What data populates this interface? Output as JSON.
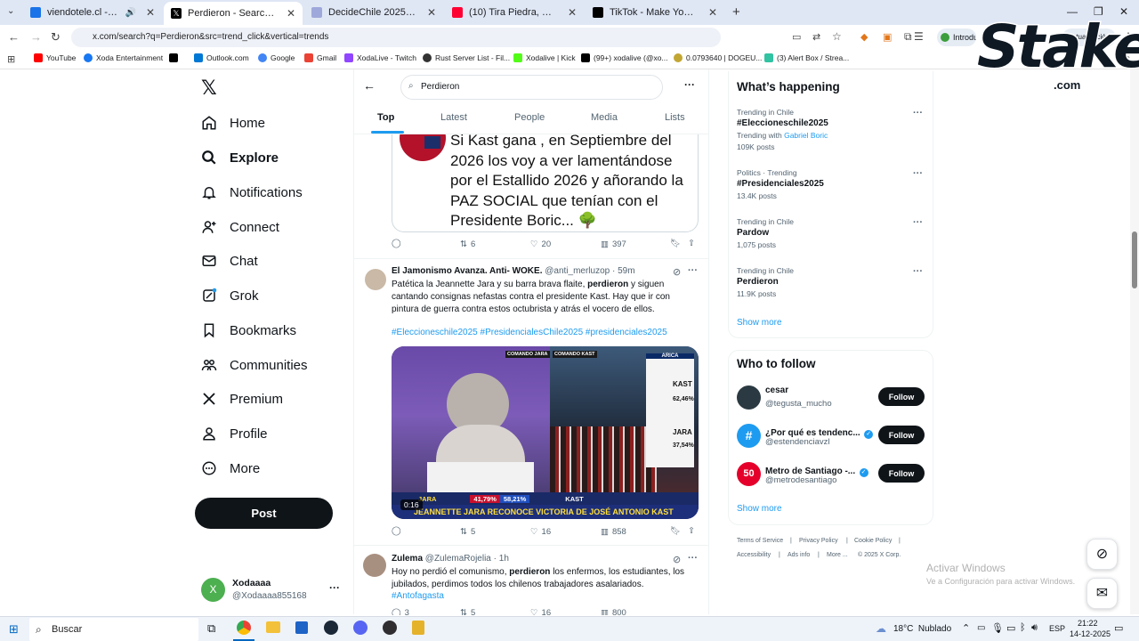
{
  "browser": {
    "tabs": [
      {
        "title": "viendotele.cl - Radios y can",
        "color": "#1a73e8"
      },
      {
        "title": "Perdieron - Search / X",
        "color": "#000000",
        "active": true
      },
      {
        "title": "DecideChile 2025 - La elección",
        "color": "#9fa8da"
      },
      {
        "title": "(10) Tira Piedra, Kuka Tira Piedra",
        "color": "#ff0033"
      },
      {
        "title": "TikTok - Make Your Day",
        "color": "#000000"
      }
    ],
    "url": "x.com/search?q=Perdieron&src=trend_click&vertical=trends",
    "profile_label": "Introdu",
    "update_label": "Actualización necesaria",
    "bookmarks": [
      {
        "label": "YouTube",
        "color": "#ff0000"
      },
      {
        "label": "Xoda Entertainment",
        "color": "#1877f2"
      },
      {
        "label": "",
        "color": "#000000"
      },
      {
        "label": "Outlook.com",
        "color": "#0078d4"
      },
      {
        "label": "Google",
        "color": "#4285f4"
      },
      {
        "label": "Gmail",
        "color": "#ea4335"
      },
      {
        "label": "XodaLive - Twitch",
        "color": "#9146ff"
      },
      {
        "label": "Rust Server List - Fil...",
        "color": "#333333"
      },
      {
        "label": "Xodalive | Kick",
        "color": "#53fc18"
      },
      {
        "label": "(99+) xodalive (@xo...",
        "color": "#000000"
      },
      {
        "label": "0.0793640 | DOGEU...",
        "color": "#c2a633"
      },
      {
        "label": "(3) Alert Box / Strea...",
        "color": "#31c3a2"
      }
    ],
    "bookmarks_more": "res"
  },
  "overlay": {
    "stake_logo": "Stake",
    "stake_sub": ".com"
  },
  "nav": {
    "items": [
      {
        "label": "Home",
        "icon": "home-icon"
      },
      {
        "label": "Explore",
        "icon": "search-icon"
      },
      {
        "label": "Notifications",
        "icon": "bell-icon"
      },
      {
        "label": "Connect",
        "icon": "person-plus-icon"
      },
      {
        "label": "Chat",
        "icon": "mail-icon"
      },
      {
        "label": "Grok",
        "icon": "grok-icon"
      },
      {
        "label": "Bookmarks",
        "icon": "bookmark-icon"
      },
      {
        "label": "Communities",
        "icon": "communities-icon"
      },
      {
        "label": "Premium",
        "icon": "x-logo-icon"
      },
      {
        "label": "Profile",
        "icon": "person-icon"
      },
      {
        "label": "More",
        "icon": "more-circle-icon"
      }
    ],
    "post_label": "Post",
    "account": {
      "name": "Xodaaaa",
      "handle": "@Xodaaaa855168",
      "initial": "X"
    }
  },
  "search": {
    "query": "Perdieron",
    "tabs": [
      "Top",
      "Latest",
      "People",
      "Media",
      "Lists"
    ]
  },
  "tweets": [
    {
      "quote_text": "Si Kast gana , en Septiembre del 2026 los voy a ver lamentándose por el Estallido 2026 y añorando la PAZ SOCIAL que tenían con el Presidente Boric... 🌳",
      "stats": {
        "replies": "",
        "retweets": "6",
        "likes": "20",
        "views": "397"
      }
    },
    {
      "name": "El Jamonismo Avanza. Anti- WOKE.",
      "handle": "@anti_merluzop",
      "time": "· 59m",
      "text_before": "Patética la Jeannette Jara y su barra brava flaite, ",
      "highlight": "perdieron",
      "text_after": " y siguen cantando consignas nefastas contra el presidente Kast. Hay que ir con pintura de guerra contra estos octubrista y atrás el vocero de ellos.",
      "hashtags": "#Eleccioneschile2025 #PresidencialesChile2025 #presidenciales2025",
      "video": {
        "duration": "0:16",
        "left_banner": "COMANDO JARA",
        "right_banner": "COMANDO KAST",
        "region": "ARICA",
        "kast_label": "KAST",
        "kast_pct": "62,46%",
        "jara_label": "JARA",
        "jara_pct": "37,54%",
        "bar_jara": "JARA",
        "bar_jara_pct": "41,79%",
        "bar_kast_pct": "58,21%",
        "bar_kast": "KAST",
        "headline": "JEANNETTE JARA RECONOCE VICTORIA DE JOSÉ ANTONIO KAST"
      },
      "stats": {
        "replies": "",
        "retweets": "5",
        "likes": "16",
        "views": "858"
      }
    },
    {
      "name": "Zulema",
      "handle": "@ZulemaRojelia",
      "time": "· 1h",
      "text_before": "Hoy no perdió el comunismo, ",
      "highlight": "perdieron",
      "text_after": " los enfermos, los estudiantes, los jubilados, perdimos todos los chilenos trabajadores asalariados.",
      "hashtags": "#Antofagasta",
      "stats": {
        "replies": "3",
        "retweets": "5",
        "likes": "16",
        "views": "800"
      }
    }
  ],
  "right": {
    "happening_title": "What’s happening",
    "trends": [
      {
        "context": "Trending in Chile",
        "name": "#Eleccioneschile2025",
        "with_prefix": "Trending with ",
        "with": "Gabriel Boric",
        "posts": "109K posts"
      },
      {
        "context": "Politics · Trending",
        "name": "#Presidenciales2025",
        "posts": "13.4K posts"
      },
      {
        "context": "Trending in Chile",
        "name": "Pardow",
        "posts": "1,075 posts"
      },
      {
        "context": "Trending in Chile",
        "name": "Perdieron",
        "posts": "11.9K posts"
      }
    ],
    "show_more": "Show more",
    "who_title": "Who to follow",
    "who": [
      {
        "name": "cesar",
        "handle": "@tegusta_mucho",
        "color": "#2b3a42"
      },
      {
        "name": "¿Por qué es tendenc...",
        "handle": "@estendenciavzl",
        "color": "#1d9bf0",
        "verified": true
      },
      {
        "name": "Metro de Santiago -...",
        "handle": "@metrodesantiago",
        "color": "#e4002b",
        "verified": true
      }
    ],
    "follow_label": "Follow",
    "footer": [
      "Terms of Service",
      "Privacy Policy",
      "Cookie Policy",
      "Accessibility",
      "Ads info",
      "More ...",
      "© 2025 X Corp."
    ]
  },
  "watermark": {
    "line1": "Activar Windows",
    "line2": "Ve a Configuración para activar Windows."
  },
  "taskbar": {
    "search": "Buscar",
    "weather": "18°C  Nublado",
    "lang": "ESP",
    "time": "21:22",
    "date": "14-12-2025"
  }
}
